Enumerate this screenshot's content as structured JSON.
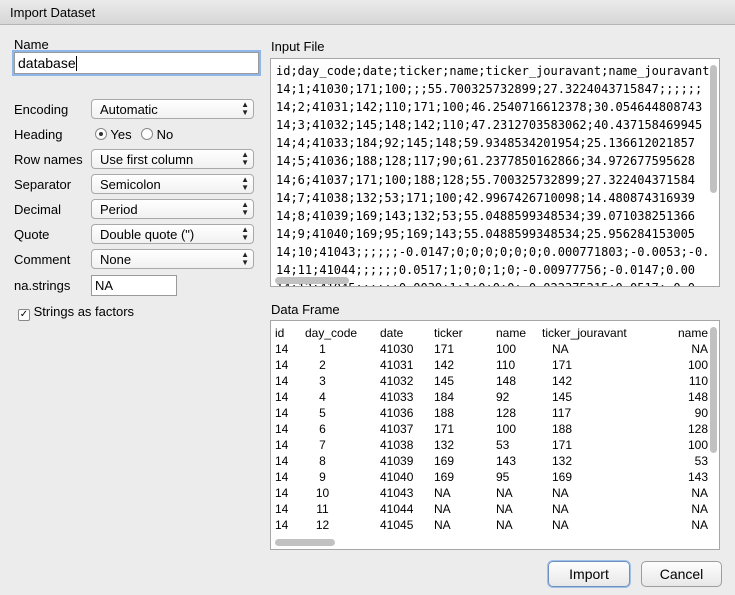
{
  "window": {
    "title": "Import Dataset"
  },
  "name": {
    "label": "Name",
    "value": "database"
  },
  "options": {
    "encoding": {
      "label": "Encoding",
      "value": "Automatic"
    },
    "heading": {
      "label": "Heading",
      "yes": "Yes",
      "no": "No",
      "selected": "Yes"
    },
    "row_names": {
      "label": "Row names",
      "value": "Use first column"
    },
    "separator": {
      "label": "Separator",
      "value": "Semicolon"
    },
    "decimal": {
      "label": "Decimal",
      "value": "Period"
    },
    "quote": {
      "label": "Quote",
      "value": "Double quote (\")"
    },
    "comment": {
      "label": "Comment",
      "value": "None"
    },
    "na_strings": {
      "label": "na.strings",
      "value": "NA"
    },
    "strings_as_factors": {
      "label": "Strings as factors",
      "checked": true,
      "check_glyph": "✓"
    }
  },
  "input_file": {
    "label": "Input File",
    "lines": [
      "id;day_code;date;ticker;name;ticker_jouravant;name_jouravant",
      "14;1;41030;171;100;;;55.700325732899;27.3224043715847;;;;;;",
      "14;2;41031;142;110;171;100;46.2540716612378;30.054644808743",
      "14;3;41032;145;148;142;110;47.2312703583062;40.437158469945",
      "14;4;41033;184;92;145;148;59.9348534201954;25.136612021857",
      "14;5;41036;188;128;117;90;61.2377850162866;34.972677595628",
      "14;6;41037;171;100;188;128;55.700325732899;27.322404371584",
      "14;7;41038;132;53;171;100;42.9967426710098;14.480874316939",
      "14;8;41039;169;143;132;53;55.0488599348534;39.071038251366",
      "14;9;41040;169;95;169;143;55.0488599348534;25.956284153005",
      "14;10;41043;;;;;;-0.0147;0;0;0;0;0;0;0.000771803;-0.0053;-0.",
      "14;11;41044;;;;;;0.0517;1;0;0;1;0;-0.00977756;-0.0147;0.00",
      "14;12;41045;;;;;;0.0039;1;1;0;0;0;-0.022375215;0.0517;-0.0"
    ]
  },
  "data_frame": {
    "label": "Data Frame",
    "columns": [
      "id",
      "day_code",
      "date",
      "ticker",
      "name",
      "ticker_jouravant",
      "name"
    ],
    "rows": [
      [
        "14",
        "1",
        "41030",
        "171",
        "100",
        "NA",
        "NA"
      ],
      [
        "14",
        "2",
        "41031",
        "142",
        "110",
        "171",
        "100"
      ],
      [
        "14",
        "3",
        "41032",
        "145",
        "148",
        "142",
        "110"
      ],
      [
        "14",
        "4",
        "41033",
        "184",
        "92",
        "145",
        "148"
      ],
      [
        "14",
        "5",
        "41036",
        "188",
        "128",
        "117",
        "90"
      ],
      [
        "14",
        "6",
        "41037",
        "171",
        "100",
        "188",
        "128"
      ],
      [
        "14",
        "7",
        "41038",
        "132",
        "53",
        "171",
        "100"
      ],
      [
        "14",
        "8",
        "41039",
        "169",
        "143",
        "132",
        "53"
      ],
      [
        "14",
        "9",
        "41040",
        "169",
        "95",
        "169",
        "143"
      ],
      [
        "14",
        "10",
        "41043",
        "NA",
        "NA",
        "NA",
        "NA"
      ],
      [
        "14",
        "11",
        "41044",
        "NA",
        "NA",
        "NA",
        "NA"
      ],
      [
        "14",
        "12",
        "41045",
        "NA",
        "NA",
        "NA",
        "NA"
      ]
    ]
  },
  "buttons": {
    "import": "Import",
    "cancel": "Cancel"
  },
  "icons": {
    "select_arrows": "up-down-chevron-icon"
  }
}
